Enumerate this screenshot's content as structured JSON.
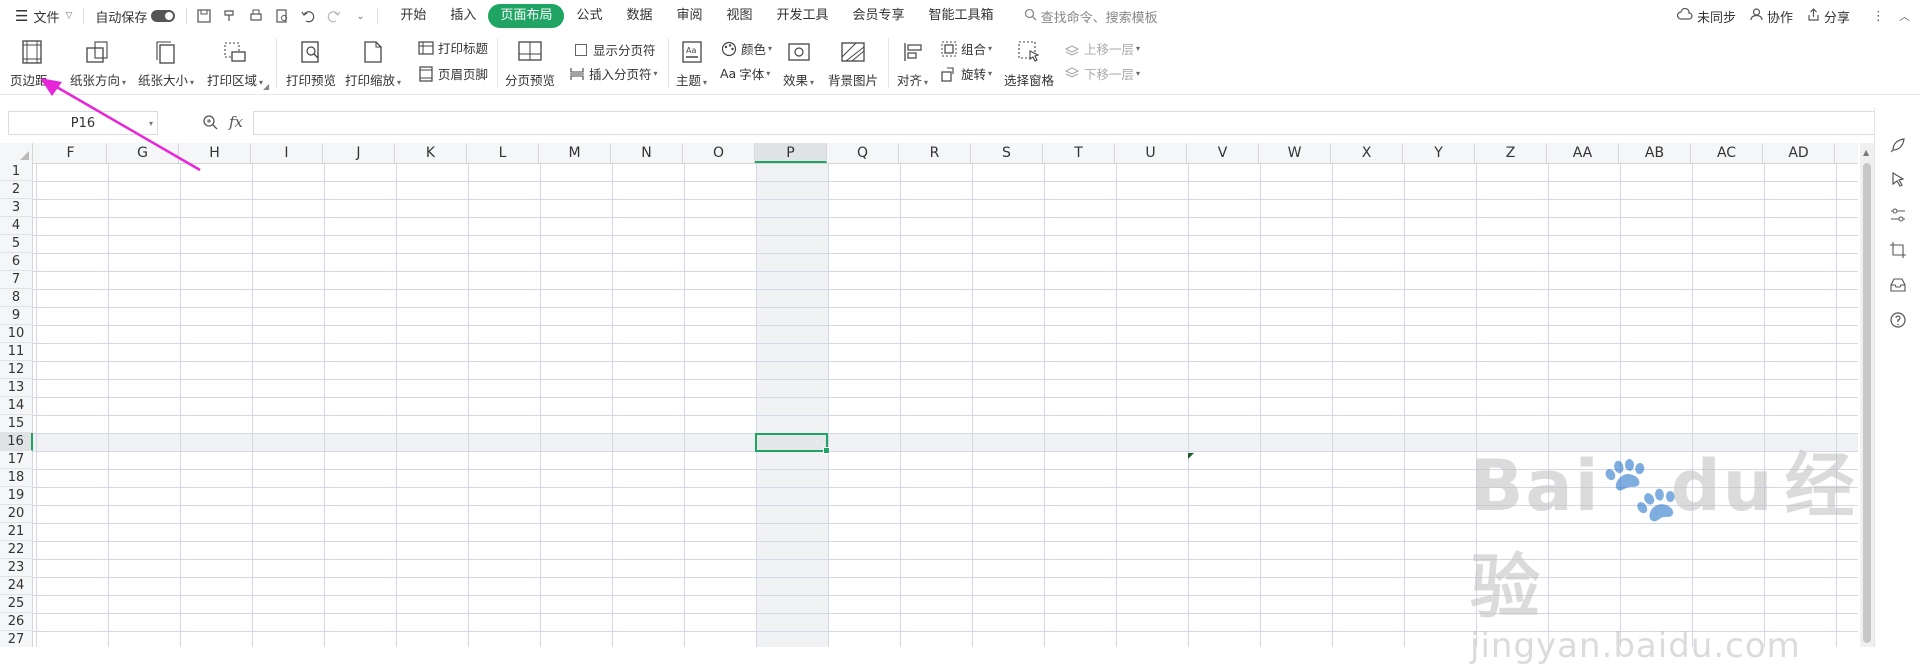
{
  "topbar": {
    "menu_label": "文件",
    "autosave_label": "自动保存",
    "tabs": [
      "开始",
      "插入",
      "页面布局",
      "公式",
      "数据",
      "审阅",
      "视图",
      "开发工具",
      "会员专享",
      "智能工具箱"
    ],
    "active_tab": "页面布局",
    "search_placeholder": "查找命令、搜索模板",
    "sync_label": "未同步",
    "collab_label": "协作",
    "share_label": "分享"
  },
  "ribbon": {
    "margins": "页边距",
    "orientation": "纸张方向",
    "size": "纸张大小",
    "print_area": "打印区域",
    "print_preview": "打印预览",
    "print_scale": "打印缩放",
    "print_titles": "打印标题",
    "header_footer": "页眉页脚",
    "page_break_preview": "分页预览",
    "show_page_breaks": "显示分页符",
    "insert_page_break": "插入分页符",
    "theme": "主题",
    "colors": "颜色",
    "fonts": "字体",
    "fonts_prefix": "Aa",
    "effects": "效果",
    "background": "背景图片",
    "align": "对齐",
    "group": "组合",
    "rotate": "旋转",
    "selection_pane": "选择窗格",
    "bring_forward": "上移一层",
    "send_backward": "下移一层"
  },
  "formula_bar": {
    "name_box": "P16",
    "fx": "fx",
    "value": ""
  },
  "sheet": {
    "columns": [
      "F",
      "G",
      "H",
      "I",
      "J",
      "K",
      "L",
      "M",
      "N",
      "O",
      "P",
      "Q",
      "R",
      "S",
      "T",
      "U",
      "V",
      "W",
      "X",
      "Y",
      "Z",
      "AA",
      "AB",
      "AC",
      "AD"
    ],
    "selected_column": "P",
    "rows": [
      "1",
      "2",
      "3",
      "4",
      "5",
      "6",
      "7",
      "8",
      "9",
      "10",
      "11",
      "12",
      "13",
      "14",
      "15",
      "16",
      "17",
      "18",
      "19",
      "20",
      "21",
      "22",
      "23",
      "24",
      "25",
      "26",
      "27"
    ],
    "selected_row": "16"
  },
  "watermark": {
    "brand": "Bai",
    "brand2": "du",
    "brand_cn": "经验",
    "url": "jingyan.baidu.com"
  },
  "colors": {
    "accent": "#1fa463",
    "annotation_arrow": "#e826d9"
  }
}
